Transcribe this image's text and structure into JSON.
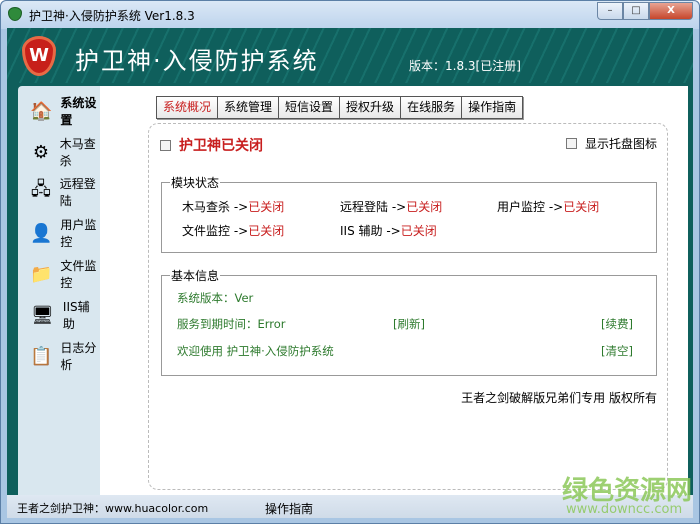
{
  "window": {
    "title": "护卫神·入侵防护系统 Ver1.8.3",
    "minimize": "–",
    "maximize": "□",
    "close": "X"
  },
  "header": {
    "logo_text": "W",
    "title": "护卫神·入侵防护系统",
    "version": "版本：1.8.3[已注册]"
  },
  "sidebar": {
    "items": [
      {
        "label": "系统设置",
        "icon": "home-icon",
        "glyph": "🏠"
      },
      {
        "label": "木马查杀",
        "icon": "gear-scroll-icon",
        "glyph": "⚙"
      },
      {
        "label": "远程登陆",
        "icon": "network-icon",
        "glyph": "🖧"
      },
      {
        "label": "用户监控",
        "icon": "user-icon",
        "glyph": "👤"
      },
      {
        "label": "文件监控",
        "icon": "file-icon",
        "glyph": "📁"
      },
      {
        "label": "IIS辅助",
        "icon": "server-icon",
        "glyph": "🖥"
      },
      {
        "label": "日志分析",
        "icon": "log-icon",
        "glyph": "📋"
      }
    ]
  },
  "tabs": [
    "系统概况",
    "系统管理",
    "短信设置",
    "授权升级",
    "在线服务",
    "操作指南"
  ],
  "overview": {
    "status_label": "护卫神已关闭",
    "tray_label": "显示托盘图标",
    "module_group": "模块状态",
    "modules": [
      {
        "name": "木马查杀 ->",
        "state": "已关闭"
      },
      {
        "name": "远程登陆 ->",
        "state": "已关闭"
      },
      {
        "name": "用户监控 ->",
        "state": "已关闭"
      },
      {
        "name": "文件监控 ->",
        "state": "已关闭"
      },
      {
        "name": "IIS 辅助 ->",
        "state": "已关闭"
      }
    ],
    "info_group": "基本信息",
    "sys_version": "系统版本：Ver",
    "expire": "服务到期时间：Error",
    "refresh": "[刷新]",
    "renew": "[续费]",
    "welcome": "欢迎使用 护卫神·入侵防护系统",
    "clear": "[清空]",
    "copyright": "王者之剑破解版兄弟们专用 版权所有"
  },
  "statusbar": {
    "left": "王者之剑护卫神：www.huacolor.com",
    "guide": "操作指南"
  },
  "watermark": {
    "title": "绿色资源网",
    "url": "www.downcc.com"
  }
}
